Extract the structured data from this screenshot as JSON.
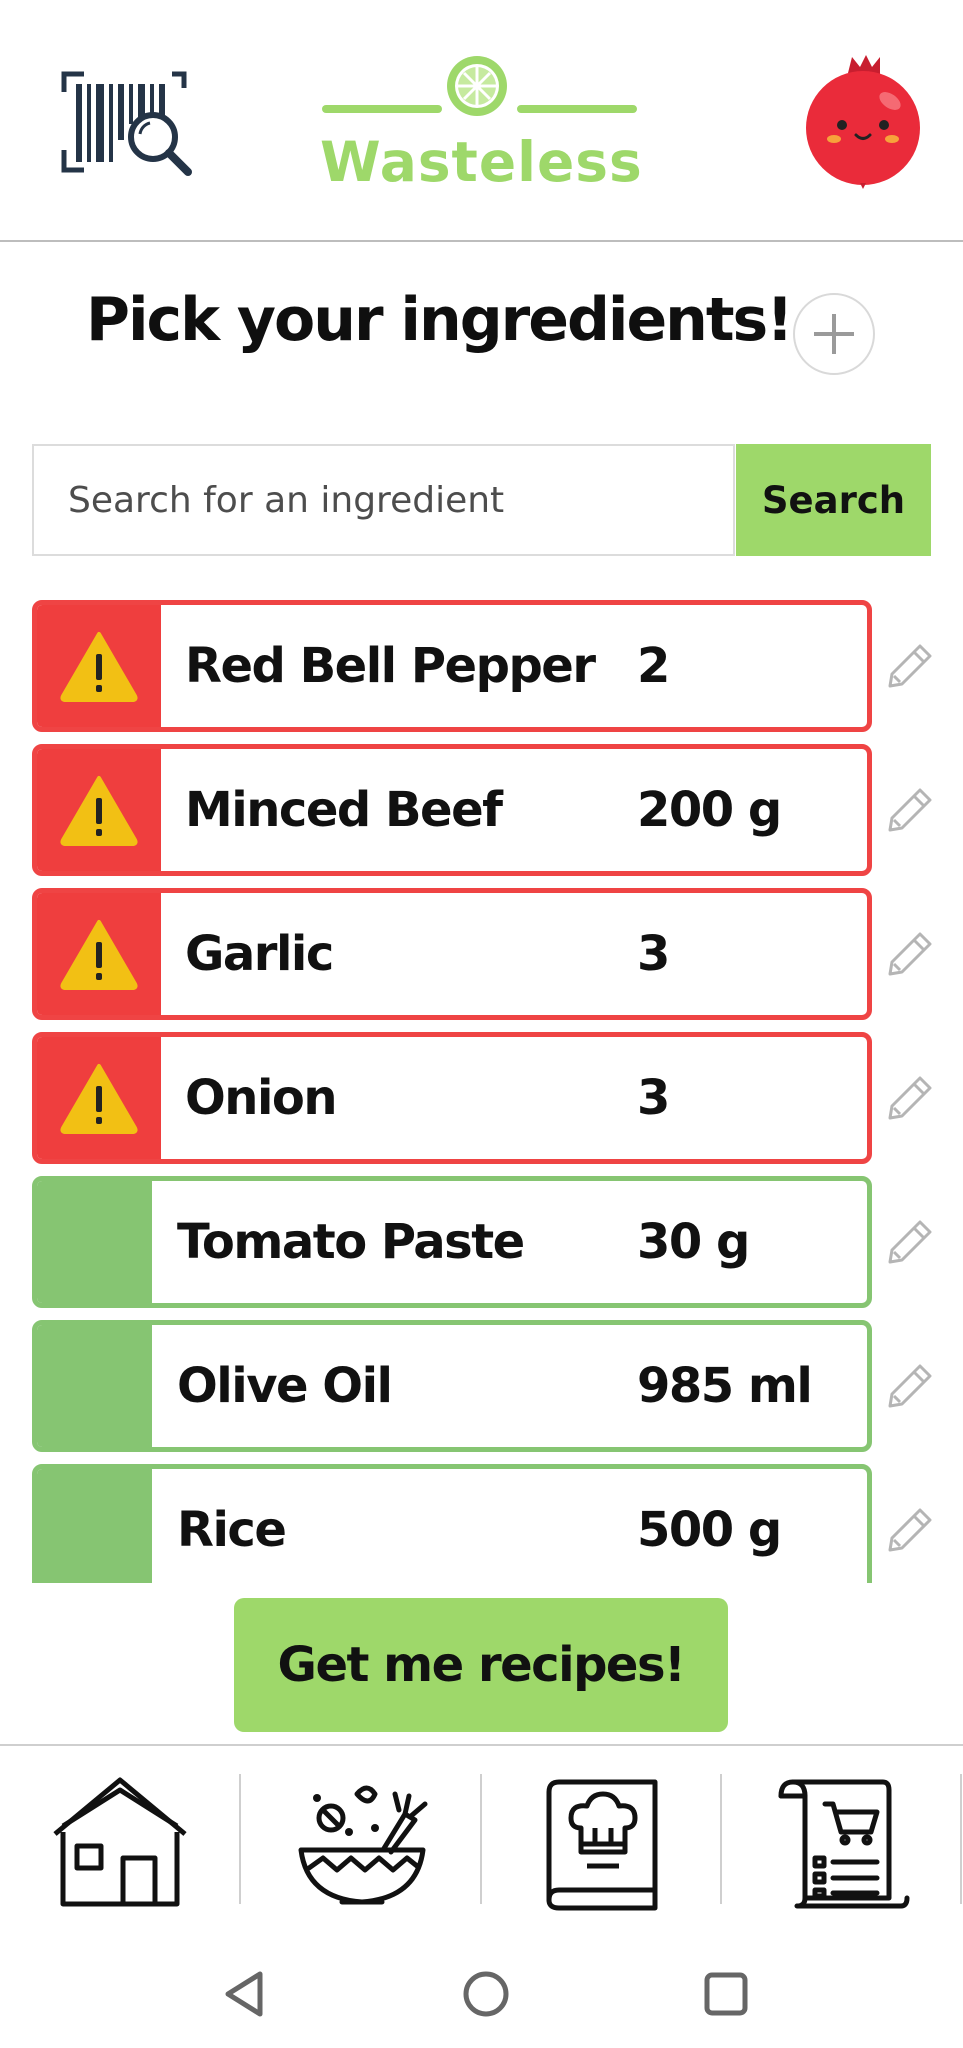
{
  "header": {
    "logo_text": "Wasteless",
    "brand_color": "#9ed86a",
    "scan_icon": "barcode-scan-icon",
    "avatar_icon": "pomegranate-avatar-icon"
  },
  "page": {
    "title": "Pick your ingredients!",
    "add_icon": "plus-icon"
  },
  "search": {
    "placeholder": "Search for an ingredient",
    "value": "",
    "button_label": "Search"
  },
  "ingredients": [
    {
      "name": "Red Bell Pepper",
      "quantity": "2",
      "status": "expiring",
      "icon": "warning-icon"
    },
    {
      "name": "Minced Beef",
      "quantity": "200 g",
      "status": "expiring",
      "icon": "warning-icon"
    },
    {
      "name": "Garlic",
      "quantity": "3",
      "status": "expiring",
      "icon": "warning-icon"
    },
    {
      "name": "Onion",
      "quantity": "3",
      "status": "expiring",
      "icon": "warning-icon"
    },
    {
      "name": "Tomato Paste",
      "quantity": "30 g",
      "status": "fresh",
      "icon": ""
    },
    {
      "name": "Olive Oil",
      "quantity": "985 ml",
      "status": "fresh",
      "icon": ""
    },
    {
      "name": "Rice",
      "quantity": "500 g",
      "status": "fresh",
      "icon": ""
    }
  ],
  "colors": {
    "expiring": "#ef3e3e",
    "fresh": "#86c572",
    "warning": "#f2c014"
  },
  "cta": {
    "label": "Get me recipes!"
  },
  "bottom_nav": [
    {
      "id": "home",
      "icon": "house-icon"
    },
    {
      "id": "salad",
      "icon": "salad-bowl-icon"
    },
    {
      "id": "recipes",
      "icon": "cookbook-icon"
    },
    {
      "id": "shopping-list",
      "icon": "shopping-list-icon"
    }
  ],
  "system_nav": [
    {
      "id": "back",
      "icon": "back-triangle-icon"
    },
    {
      "id": "home",
      "icon": "home-circle-icon"
    },
    {
      "id": "recents",
      "icon": "recents-square-icon"
    }
  ]
}
